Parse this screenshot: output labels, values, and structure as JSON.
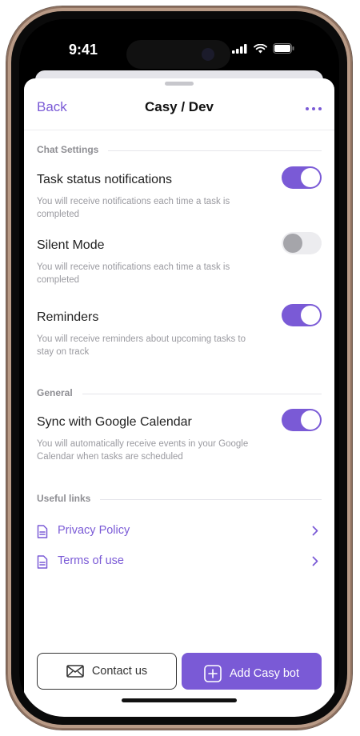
{
  "status_bar": {
    "time": "9:41"
  },
  "nav": {
    "back_label": "Back",
    "title": "Casy / Dev"
  },
  "sections": {
    "chat_settings": "Chat Settings",
    "general": "General",
    "useful_links": "Useful links"
  },
  "settings": [
    {
      "name": "Task status notifications",
      "desc": "You will receive notifications each time a task is completed",
      "enabled": true
    },
    {
      "name": "Silent Mode",
      "desc": "You will receive notifications each time a task is completed",
      "enabled": false
    },
    {
      "name": "Reminders",
      "desc": "You will receive reminders about upcoming tasks to stay on track",
      "enabled": true
    },
    {
      "name": "Sync with Google Calendar",
      "desc": "You will automatically receive events in your Google Calendar when tasks are scheduled",
      "enabled": true
    }
  ],
  "links": [
    {
      "label": "Privacy Policy"
    },
    {
      "label": "Terms of use"
    }
  ],
  "buttons": {
    "contact": "Contact us",
    "add_bot": "Add Casy bot"
  },
  "colors": {
    "accent": "#7a5ad6",
    "toggle_off": "#ececef"
  }
}
